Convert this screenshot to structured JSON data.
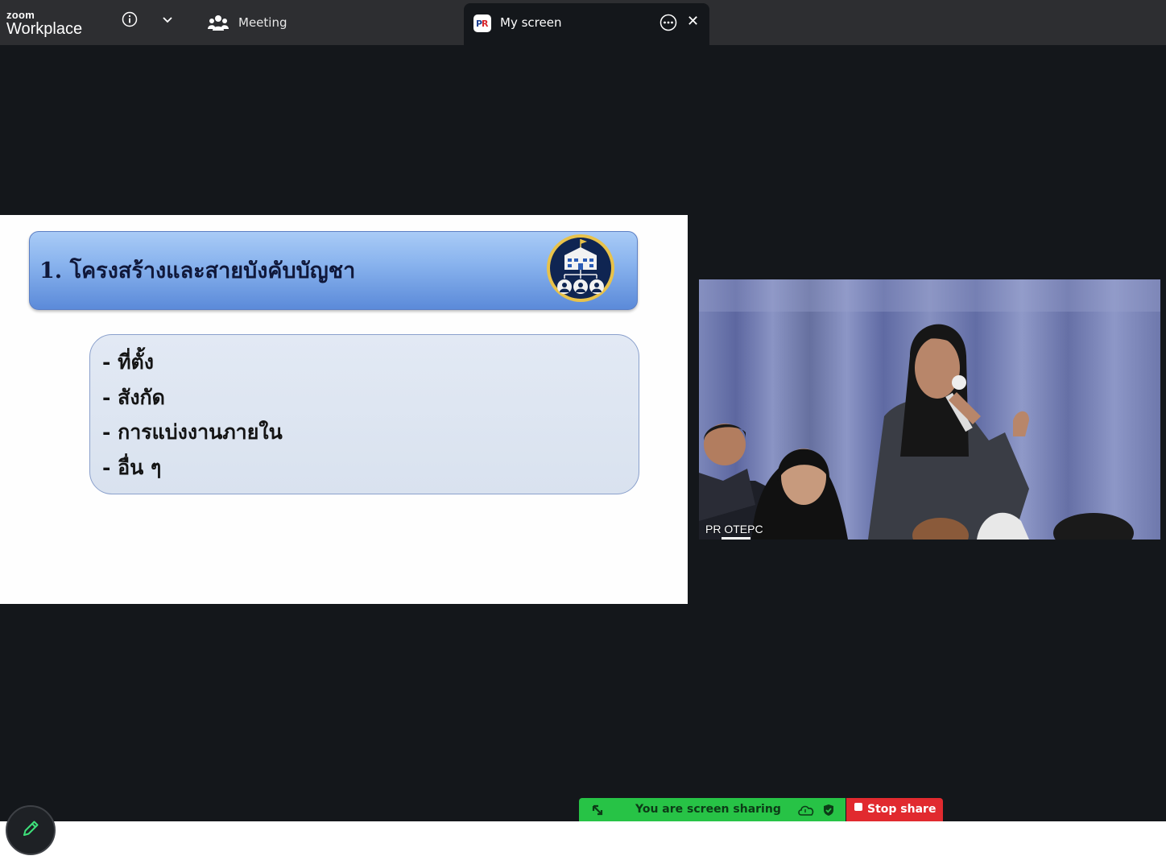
{
  "app": {
    "brand_top": "zoom",
    "brand_bottom": "Workplace"
  },
  "tabs": [
    {
      "label": "Meeting",
      "icon": "participants-icon"
    },
    {
      "label": "My screen",
      "icon": "pr-logo-icon",
      "active": true
    }
  ],
  "slide": {
    "title": "1. โครงสร้างและสายบังคับบัญชา",
    "bullets": [
      "- ที่ตั้ง",
      "- สังกัด",
      "- การแบ่งงานภายใน",
      "- อื่น ๆ"
    ],
    "header_color": "#8ab4ee"
  },
  "video": {
    "participant_name": "PR OTEPC"
  },
  "share_bar": {
    "status": "You are screen sharing",
    "stop_label": "Stop share",
    "green": "#27c346",
    "red": "#e12a2f"
  }
}
